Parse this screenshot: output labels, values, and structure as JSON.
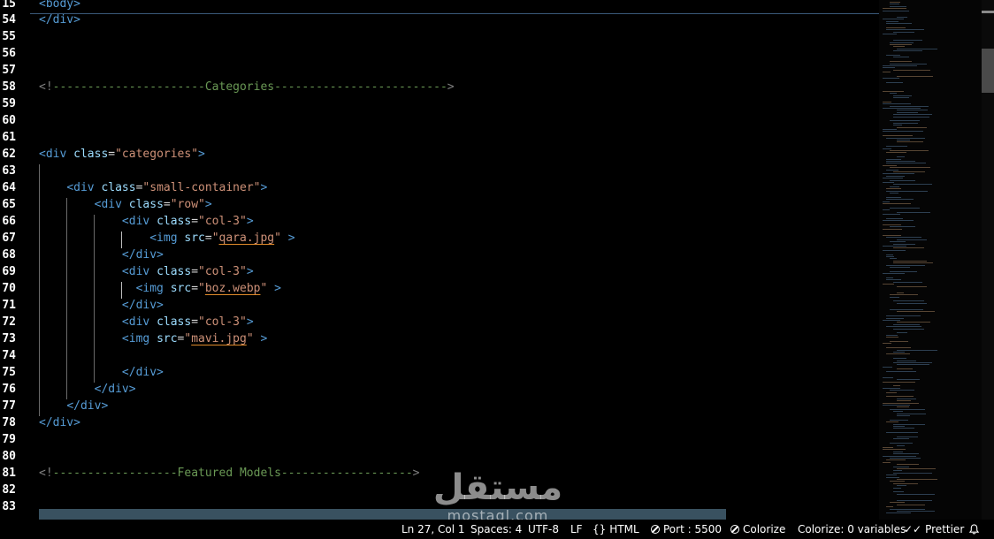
{
  "sticky": {
    "line_number": "15",
    "code": [
      {
        "t": "tag",
        "v": "<body>"
      }
    ]
  },
  "lines": [
    {
      "n": "54",
      "code": [
        {
          "t": "tag",
          "v": "</div>"
        }
      ]
    },
    {
      "n": "55",
      "code": []
    },
    {
      "n": "56",
      "code": []
    },
    {
      "n": "57",
      "code": []
    },
    {
      "n": "58",
      "code": [
        {
          "t": "punc",
          "v": "<!"
        },
        {
          "t": "comment",
          "v": "----------------------Categories-------------------------"
        },
        {
          "t": "punc",
          "v": ">"
        }
      ]
    },
    {
      "n": "59",
      "code": []
    },
    {
      "n": "60",
      "code": []
    },
    {
      "n": "61",
      "code": []
    },
    {
      "n": "62",
      "code": [
        {
          "t": "tag",
          "v": "<div"
        },
        {
          "t": "text",
          "v": " "
        },
        {
          "t": "attr",
          "v": "class"
        },
        {
          "t": "text",
          "v": "="
        },
        {
          "t": "str",
          "v": "\"categories\""
        },
        {
          "t": "tag",
          "v": ">"
        }
      ]
    },
    {
      "n": "63",
      "code": []
    },
    {
      "n": "64",
      "code": [
        {
          "t": "text",
          "v": "    "
        },
        {
          "t": "tag",
          "v": "<div"
        },
        {
          "t": "text",
          "v": " "
        },
        {
          "t": "attr",
          "v": "class"
        },
        {
          "t": "text",
          "v": "="
        },
        {
          "t": "str",
          "v": "\"small-container\""
        },
        {
          "t": "tag",
          "v": ">"
        }
      ]
    },
    {
      "n": "65",
      "code": [
        {
          "t": "text",
          "v": "        "
        },
        {
          "t": "tag",
          "v": "<div"
        },
        {
          "t": "text",
          "v": " "
        },
        {
          "t": "attr",
          "v": "class"
        },
        {
          "t": "text",
          "v": "="
        },
        {
          "t": "str",
          "v": "\"row\""
        },
        {
          "t": "tag",
          "v": ">"
        }
      ]
    },
    {
      "n": "66",
      "code": [
        {
          "t": "text",
          "v": "            "
        },
        {
          "t": "tag",
          "v": "<div"
        },
        {
          "t": "text",
          "v": " "
        },
        {
          "t": "attr",
          "v": "class"
        },
        {
          "t": "text",
          "v": "="
        },
        {
          "t": "str",
          "v": "\"col-3\""
        },
        {
          "t": "tag",
          "v": ">"
        }
      ]
    },
    {
      "n": "67",
      "code": [
        {
          "t": "text",
          "v": "                "
        },
        {
          "t": "tag",
          "v": "<img"
        },
        {
          "t": "text",
          "v": " "
        },
        {
          "t": "attr",
          "v": "src"
        },
        {
          "t": "text",
          "v": "="
        },
        {
          "t": "str",
          "v": "\""
        },
        {
          "t": "link",
          "v": "qara.jpg"
        },
        {
          "t": "str",
          "v": "\""
        },
        {
          "t": "text",
          "v": " "
        },
        {
          "t": "tag",
          "v": ">"
        }
      ]
    },
    {
      "n": "68",
      "code": [
        {
          "t": "text",
          "v": "            "
        },
        {
          "t": "tag",
          "v": "</div>"
        }
      ]
    },
    {
      "n": "69",
      "code": [
        {
          "t": "text",
          "v": "            "
        },
        {
          "t": "tag",
          "v": "<div"
        },
        {
          "t": "text",
          "v": " "
        },
        {
          "t": "attr",
          "v": "class"
        },
        {
          "t": "text",
          "v": "="
        },
        {
          "t": "str",
          "v": "\"col-3\""
        },
        {
          "t": "tag",
          "v": ">"
        }
      ]
    },
    {
      "n": "70",
      "code": [
        {
          "t": "text",
          "v": "              "
        },
        {
          "t": "tag",
          "v": "<img"
        },
        {
          "t": "text",
          "v": " "
        },
        {
          "t": "attr",
          "v": "src"
        },
        {
          "t": "text",
          "v": "="
        },
        {
          "t": "str",
          "v": "\""
        },
        {
          "t": "link",
          "v": "boz.webp"
        },
        {
          "t": "str",
          "v": "\""
        },
        {
          "t": "text",
          "v": " "
        },
        {
          "t": "tag",
          "v": ">"
        }
      ]
    },
    {
      "n": "71",
      "code": [
        {
          "t": "text",
          "v": "            "
        },
        {
          "t": "tag",
          "v": "</div>"
        }
      ]
    },
    {
      "n": "72",
      "code": [
        {
          "t": "text",
          "v": "            "
        },
        {
          "t": "tag",
          "v": "<div"
        },
        {
          "t": "text",
          "v": " "
        },
        {
          "t": "attr",
          "v": "class"
        },
        {
          "t": "text",
          "v": "="
        },
        {
          "t": "str",
          "v": "\"col-3\""
        },
        {
          "t": "tag",
          "v": ">"
        }
      ]
    },
    {
      "n": "73",
      "code": [
        {
          "t": "text",
          "v": "            "
        },
        {
          "t": "tag",
          "v": "<img"
        },
        {
          "t": "text",
          "v": " "
        },
        {
          "t": "attr",
          "v": "src"
        },
        {
          "t": "text",
          "v": "="
        },
        {
          "t": "str",
          "v": "\""
        },
        {
          "t": "link",
          "v": "mavi.jpg"
        },
        {
          "t": "str",
          "v": "\""
        },
        {
          "t": "text",
          "v": " "
        },
        {
          "t": "tag",
          "v": ">"
        }
      ]
    },
    {
      "n": "74",
      "code": []
    },
    {
      "n": "75",
      "code": [
        {
          "t": "text",
          "v": "            "
        },
        {
          "t": "tag",
          "v": "</div>"
        }
      ]
    },
    {
      "n": "76",
      "code": [
        {
          "t": "text",
          "v": "        "
        },
        {
          "t": "tag",
          "v": "</div>"
        }
      ]
    },
    {
      "n": "77",
      "code": [
        {
          "t": "text",
          "v": "    "
        },
        {
          "t": "tag",
          "v": "</div>"
        }
      ]
    },
    {
      "n": "78",
      "code": [
        {
          "t": "tag",
          "v": "</div>"
        }
      ]
    },
    {
      "n": "79",
      "code": []
    },
    {
      "n": "80",
      "code": []
    },
    {
      "n": "81",
      "code": [
        {
          "t": "punc",
          "v": "<!"
        },
        {
          "t": "comment",
          "v": "------------------Featured Models-------------------"
        },
        {
          "t": "punc",
          "v": ">"
        }
      ]
    },
    {
      "n": "82",
      "code": []
    },
    {
      "n": "83",
      "code": []
    }
  ],
  "watermark": {
    "arabic": "مستقل",
    "latin": "mostaql.com"
  },
  "statusbar": {
    "position": "Ln 27, Col 1",
    "spaces": "Spaces: 4",
    "encoding": "UTF-8",
    "eol": "LF",
    "language": "HTML",
    "port": "Port : 5500",
    "colorize": "Colorize",
    "colorize_vars": "Colorize: 0 variables",
    "prettier": "Prettier"
  },
  "colors": {
    "tag": "#569cd6",
    "attr": "#9cdcfe",
    "string": "#ce9178",
    "comment": "#6a9955",
    "background": "#000000"
  }
}
